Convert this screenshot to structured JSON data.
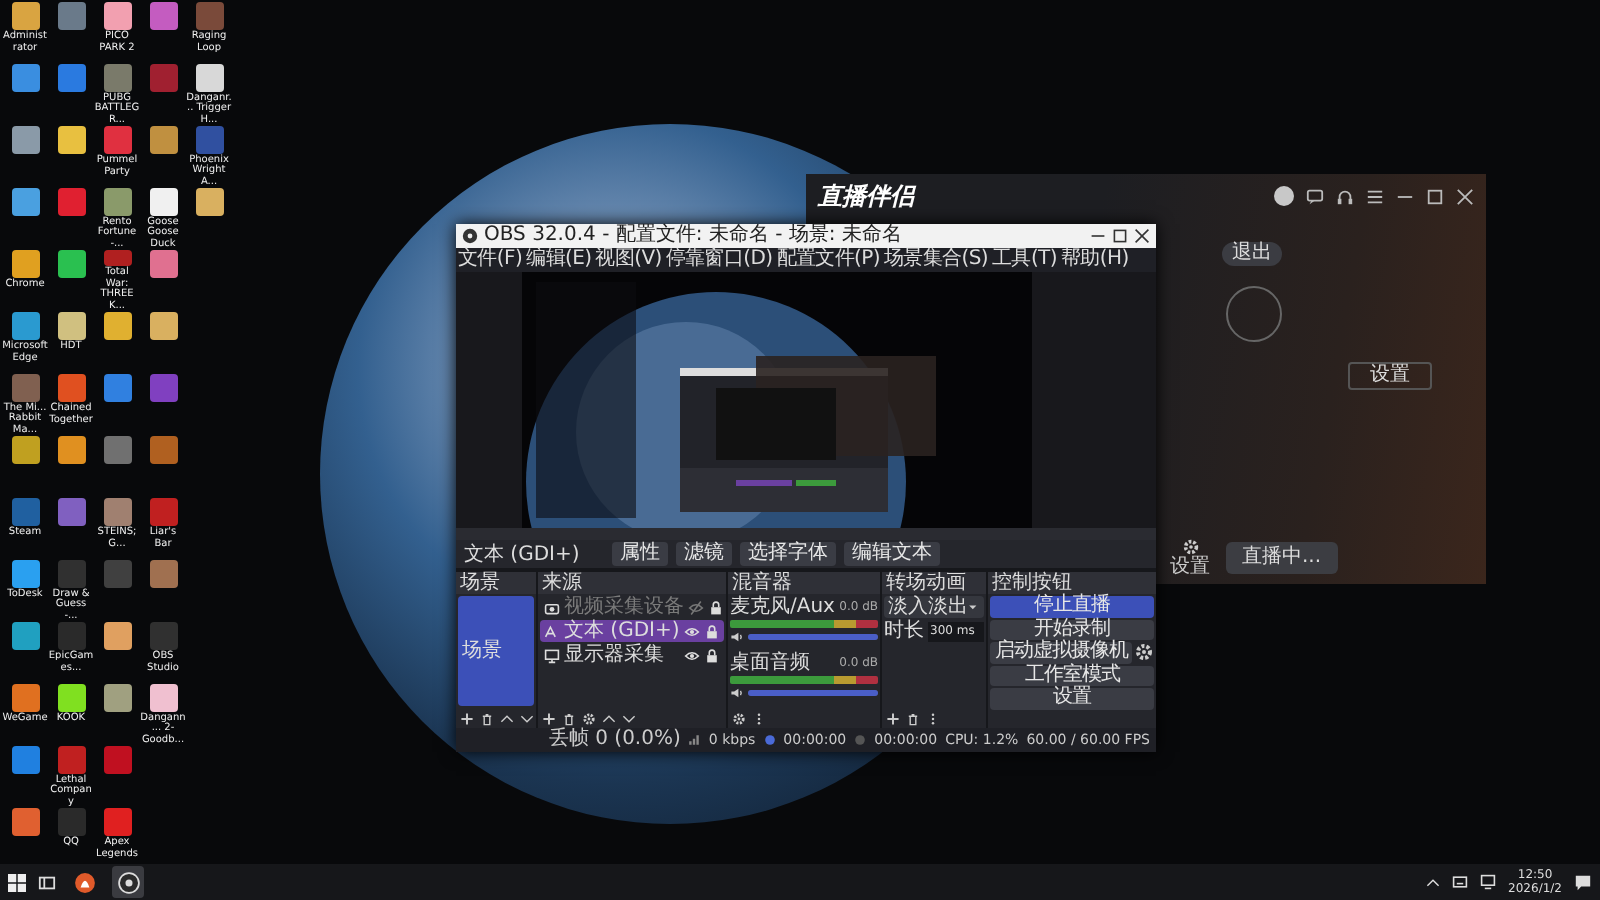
{
  "desktop": {
    "icon_rows": [
      [
        {
          "label": "Administrator",
          "color": "#d9a441"
        },
        {
          "color": "#6a7a8a"
        },
        {
          "label": "PICO PARK 2",
          "color": "#f2a0b0"
        },
        {
          "color": "#c45cc0"
        },
        {
          "label": "Raging Loop",
          "color": "#7a4a3a"
        }
      ],
      [
        {
          "color": "#3a8ee0"
        },
        {
          "color": "#2a7ae0"
        },
        {
          "label": "PUBG BATTLEGR...",
          "color": "#7a7a6a"
        },
        {
          "color": "#a02030"
        },
        {
          "label": "Danganr... Trigger H...",
          "color": "#d8d8d8"
        }
      ],
      [
        {
          "color": "#8a9aa8"
        },
        {
          "color": "#e8c040"
        },
        {
          "label": "Pummel Party",
          "color": "#e03040"
        },
        {
          "color": "#c09040"
        },
        {
          "label": "Phoenix Wright A...",
          "color": "#3050a0"
        }
      ],
      [
        {
          "color": "#4aa0e0"
        },
        {
          "color": "#e02030"
        },
        {
          "label": "Rento Fortune -...",
          "color": "#8a9a6a"
        },
        {
          "label": "Goose Goose Duck",
          "color": "#f0f0f0"
        },
        {
          "color": "#d9b060"
        }
      ],
      [
        {
          "label": "Chrome",
          "color": "#e0a020"
        },
        {
          "color": "#2ac050"
        },
        {
          "label": "Total War: THREE K...",
          "color": "#b02020"
        },
        {
          "color": "#e07090"
        }
      ],
      [
        {
          "label": "Microsoft Edge",
          "color": "#2a9ad0"
        },
        {
          "label": "HDT",
          "color": "#d0c080"
        },
        {
          "color": "#e0b030"
        },
        {
          "color": "#d9b060"
        }
      ],
      [
        {
          "label": "The Mi... Rabbit Ma...",
          "color": "#806050"
        },
        {
          "label": "Chained Together",
          "color": "#e05020"
        },
        {
          "color": "#3080e0"
        },
        {
          "color": "#8040c0"
        }
      ],
      [
        {
          "color": "#c0a020"
        },
        {
          "color": "#e09020"
        },
        {
          "color": "#707070"
        },
        {
          "color": "#b06020"
        }
      ],
      [
        {
          "label": "Steam",
          "color": "#2060a0"
        },
        {
          "color": "#8060c0"
        },
        {
          "label": "STEINS;G...",
          "color": "#a08070"
        },
        {
          "label": "Liar's Bar",
          "color": "#c02020"
        }
      ],
      [
        {
          "label": "ToDesk",
          "color": "#2aa0f0"
        },
        {
          "label": "Draw & Guess -...",
          "color": "#303030"
        },
        {
          "color": "#404040"
        },
        {
          "color": "#a07050"
        }
      ],
      [
        {
          "color": "#20a0c0"
        },
        {
          "label": "EpicGames...",
          "color": "#2a2a2a"
        },
        {
          "color": "#e0a060"
        },
        {
          "label": "OBS Studio",
          "color": "#303030"
        }
      ],
      [
        {
          "label": "WeGame",
          "color": "#e07020"
        },
        {
          "label": "KOOK",
          "color": "#80e020"
        },
        {
          "color": "#a0a080"
        },
        {
          "label": "Dangann... 2-Goodb...",
          "color": "#f0c0d0"
        }
      ],
      [
        {
          "color": "#2080e0"
        },
        {
          "label": "Lethal Company",
          "color": "#c02020"
        },
        {
          "color": "#c01020"
        }
      ],
      [
        {
          "color": "#e06030"
        },
        {
          "label": "QQ",
          "color": "#2a2a2a"
        },
        {
          "label": "Apex Legends",
          "color": "#e02020"
        }
      ]
    ]
  },
  "live_app": {
    "title": "直播伴侣",
    "exit_button": "退出",
    "side_button": "设置",
    "settings_label": "设置",
    "live_button": "直播中..."
  },
  "obs": {
    "title": "OBS 32.0.4 - 配置文件: 未命名 - 场景: 未命名",
    "menu": [
      "文件(F)",
      "编辑(E)",
      "视图(V)",
      "停靠窗口(D)",
      "配置文件(P)",
      "场景集合(S)",
      "工具(T)",
      "帮助(H)"
    ],
    "source_toolbar": {
      "source": "文本 (GDI+)",
      "buttons": [
        "属性",
        "滤镜",
        "选择字体",
        "编辑文本"
      ]
    },
    "scenes": {
      "title": "场景",
      "items": [
        {
          "name": "场景",
          "selected": true
        }
      ]
    },
    "sources": {
      "title": "来源",
      "items": [
        {
          "name": "视频采集设备",
          "kind": "camera",
          "selected": false,
          "visible": false
        },
        {
          "name": "文本 (GDI+)",
          "kind": "text",
          "selected": true,
          "visible": true
        },
        {
          "name": "显示器采集",
          "kind": "monitor",
          "selected": false,
          "visible": true
        }
      ]
    },
    "mixer": {
      "title": "混音器",
      "channels": [
        {
          "name": "麦克风/Aux",
          "reading": "0.0 dB",
          "level": 1
        },
        {
          "name": "桌面音频",
          "reading": "0.0 dB",
          "level": 1
        }
      ]
    },
    "transitions": {
      "title": "转场动画",
      "type": "淡入淡出",
      "duration_label": "时长",
      "duration": "300 ms"
    },
    "controls": {
      "title": "控制按钮",
      "buttons": [
        {
          "label": "停止直播",
          "active": true,
          "has_settings": false
        },
        {
          "label": "开始录制",
          "active": false,
          "has_settings": false
        },
        {
          "label": "启动虚拟摄像机",
          "active": false,
          "has_settings": true
        },
        {
          "label": "工作室模式",
          "active": false,
          "has_settings": false
        },
        {
          "label": "设置",
          "active": false,
          "has_settings": false
        }
      ]
    },
    "status": {
      "dropped": "丢帧 0 (0.0%)",
      "bitrate": "0 kbps",
      "stream_time": "00:00:00",
      "record_time": "00:00:00",
      "cpu": "CPU: 1.2%",
      "fps": "60.00 / 60.00 FPS"
    }
  },
  "taskbar": {
    "apps": [
      {
        "kind": "live",
        "active": false
      },
      {
        "kind": "obs",
        "active": true
      }
    ],
    "time": "12:50",
    "date": "2026/1/2"
  }
}
